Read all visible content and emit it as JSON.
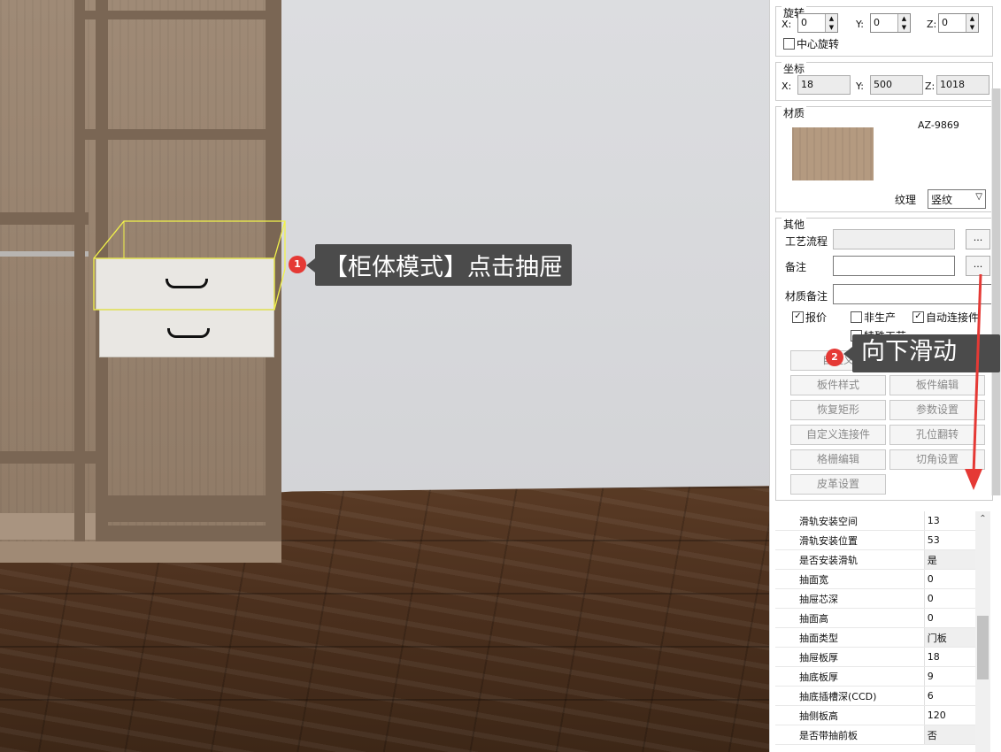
{
  "callouts": [
    {
      "num": "1",
      "text": "【柜体模式】点击抽屉"
    },
    {
      "num": "2",
      "text": "向下滑动"
    }
  ],
  "rotation": {
    "title": "旋转",
    "x_label": "X:",
    "x_value": "0",
    "y_label": "Y:",
    "y_value": "0",
    "z_label": "Z:",
    "z_value": "0",
    "center_rotate_label": "中心旋转"
  },
  "coords": {
    "title": "坐标",
    "x_label": "X:",
    "x_value": "18",
    "y_label": "Y:",
    "y_value": "500",
    "z_label": "Z:",
    "z_value": "1018"
  },
  "material": {
    "title": "材质",
    "code": "AZ-9869",
    "texture_label": "纹理",
    "texture_value": "竖纹",
    "swatch_color": "#b49a80"
  },
  "other": {
    "title": "其他",
    "process_label": "工艺流程",
    "remark_label": "备注",
    "material_remark_label": "材质备注",
    "dots": "...",
    "checks": {
      "quote": "报价",
      "non_production": "非生产",
      "auto_connector": "自动连接件",
      "special_process": "特殊工艺"
    },
    "buttons": [
      "自定义",
      "",
      "板件样式",
      "板件编辑",
      "恢复矩形",
      "参数设置",
      "自定义连接件",
      "孔位翻转",
      "格栅编辑",
      "切角设置",
      "皮革设置"
    ]
  },
  "properties": [
    {
      "key": "滑轨安装空间",
      "value": "13"
    },
    {
      "key": "滑轨安装位置",
      "value": "53"
    },
    {
      "key": "是否安装滑轨",
      "value": "是"
    },
    {
      "key": "抽面宽",
      "value": "0"
    },
    {
      "key": "抽屉芯深",
      "value": "0"
    },
    {
      "key": "抽面高",
      "value": "0"
    },
    {
      "key": "抽面类型",
      "value": "门板"
    },
    {
      "key": "抽屉板厚",
      "value": "18"
    },
    {
      "key": "抽底板厚",
      "value": "9"
    },
    {
      "key": "抽底插槽深(CCD)",
      "value": "6"
    },
    {
      "key": "抽侧板高",
      "value": "120"
    },
    {
      "key": "是否带抽前板",
      "value": "否"
    }
  ],
  "colors": {
    "callout_red": "#e53935",
    "callout_bg": "#4b4b4b",
    "selection_yellow": "#f2f24a",
    "scroll_arrow": "#e53935"
  }
}
